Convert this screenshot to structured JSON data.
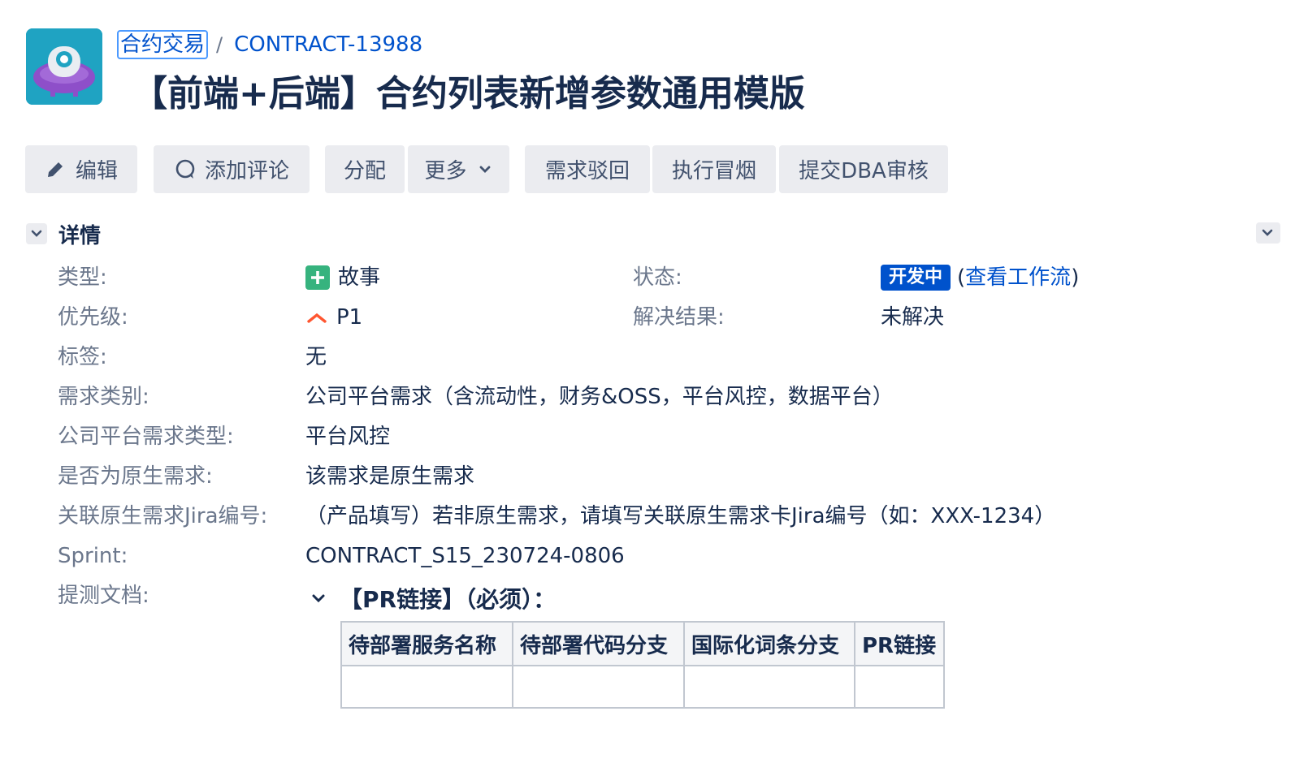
{
  "header": {
    "project_avatar": "ufo-project-avatar",
    "breadcrumb_project": "合约交易",
    "breadcrumb_separator": "/",
    "issue_key": "CONTRACT-13988",
    "title": "【前端+后端】合约列表新增参数通用模版"
  },
  "toolbar": {
    "edit": "编辑",
    "comment": "添加评论",
    "assign": "分配",
    "more": "更多",
    "reject": "需求驳回",
    "smoke": "执行冒烟",
    "dba": "提交DBA审核"
  },
  "details": {
    "title": "详情",
    "type_label": "类型:",
    "type_value": "故事",
    "priority_label": "优先级:",
    "priority_value": "P1",
    "labels_label": "标签:",
    "labels_value": "无",
    "category_label": "需求类别:",
    "category_value": "公司平台需求（含流动性，财务&OSS，平台风控，数据平台）",
    "platform_type_label": "公司平台需求类型:",
    "platform_type_value": "平台风控",
    "native_label": "是否为原生需求:",
    "native_value": "该需求是原生需求",
    "jira_link_label": "关联原生需求Jira编号:",
    "jira_link_value": "（产品填写）若非原生需求，请填写关联原生需求卡Jira编号（如：XXX-1234）",
    "sprint_label": "Sprint:",
    "sprint_value": "CONTRACT_S15_230724-0806",
    "test_doc_label": "提测文档:",
    "status_label": "状态:",
    "status_value": "开发中",
    "workflow_open": "(",
    "workflow_link": "查看工作流",
    "workflow_close": ")",
    "resolution_label": "解决结果:",
    "resolution_value": "未解决"
  },
  "test_doc": {
    "heading": "【PR链接】（必须）：",
    "columns": [
      "待部署服务名称",
      "待部署代码分支",
      "国际化词条分支",
      "PR链接"
    ],
    "rows": [
      [
        "",
        "",
        "",
        ""
      ]
    ]
  },
  "colors": {
    "link": "#0052cc",
    "status_bg": "#0052cc",
    "story_icon": "#36b37e",
    "priority_icon": "#ff5630",
    "button_bg": "#ebecf0"
  }
}
